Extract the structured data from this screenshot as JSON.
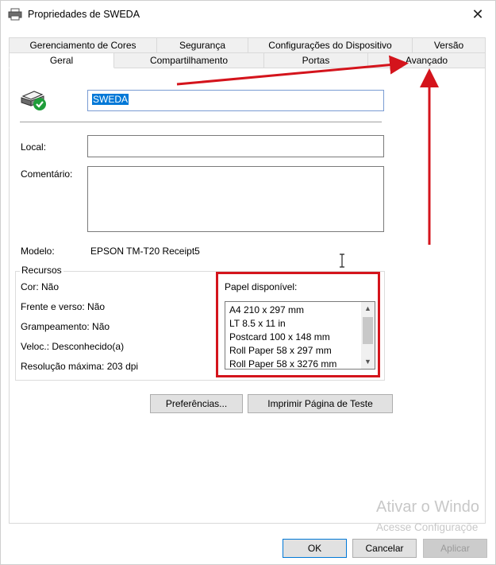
{
  "window": {
    "title": "Propriedades de SWEDA",
    "close_glyph": "✕"
  },
  "tabs_top": [
    {
      "label": "Gerenciamento de Cores"
    },
    {
      "label": "Segurança"
    },
    {
      "label": "Configurações do Dispositivo"
    },
    {
      "label": "Versão"
    }
  ],
  "tabs_bottom": [
    {
      "label": "Geral",
      "active": true
    },
    {
      "label": "Compartilhamento",
      "active": false
    },
    {
      "label": "Portas",
      "active": false
    },
    {
      "label": "Avançado",
      "active": false
    }
  ],
  "general": {
    "printer_name": "SWEDA",
    "local_label": "Local:",
    "local_value": "",
    "comment_label": "Comentário:",
    "comment_value": "",
    "model_label": "Modelo:",
    "model_value": "EPSON TM-T20 Receipt5"
  },
  "resources": {
    "title": "Recursos",
    "color": "Cor: Não",
    "duplex": "Frente e verso: Não",
    "stapling": "Grampeamento: Não",
    "speed": "Veloc.: Desconhecido(a)",
    "resolution": "Resolução máxima: 203 dpi",
    "paper_label": "Papel disponível:",
    "paper_items": [
      "A4 210 x 297 mm",
      "LT 8.5 x 11 in",
      "Postcard 100 x 148 mm",
      "Roll Paper 58 x 297 mm",
      "Roll Paper 58 x 3276 mm"
    ]
  },
  "buttons": {
    "preferences": "Preferências...",
    "print_test": "Imprimir Página de Teste",
    "ok": "OK",
    "cancel": "Cancelar",
    "apply": "Aplicar"
  },
  "watermark": {
    "line1": "Ativar o Windo",
    "line2": "Acesse Configuraçõe"
  },
  "annotation_color": "#d4141c"
}
